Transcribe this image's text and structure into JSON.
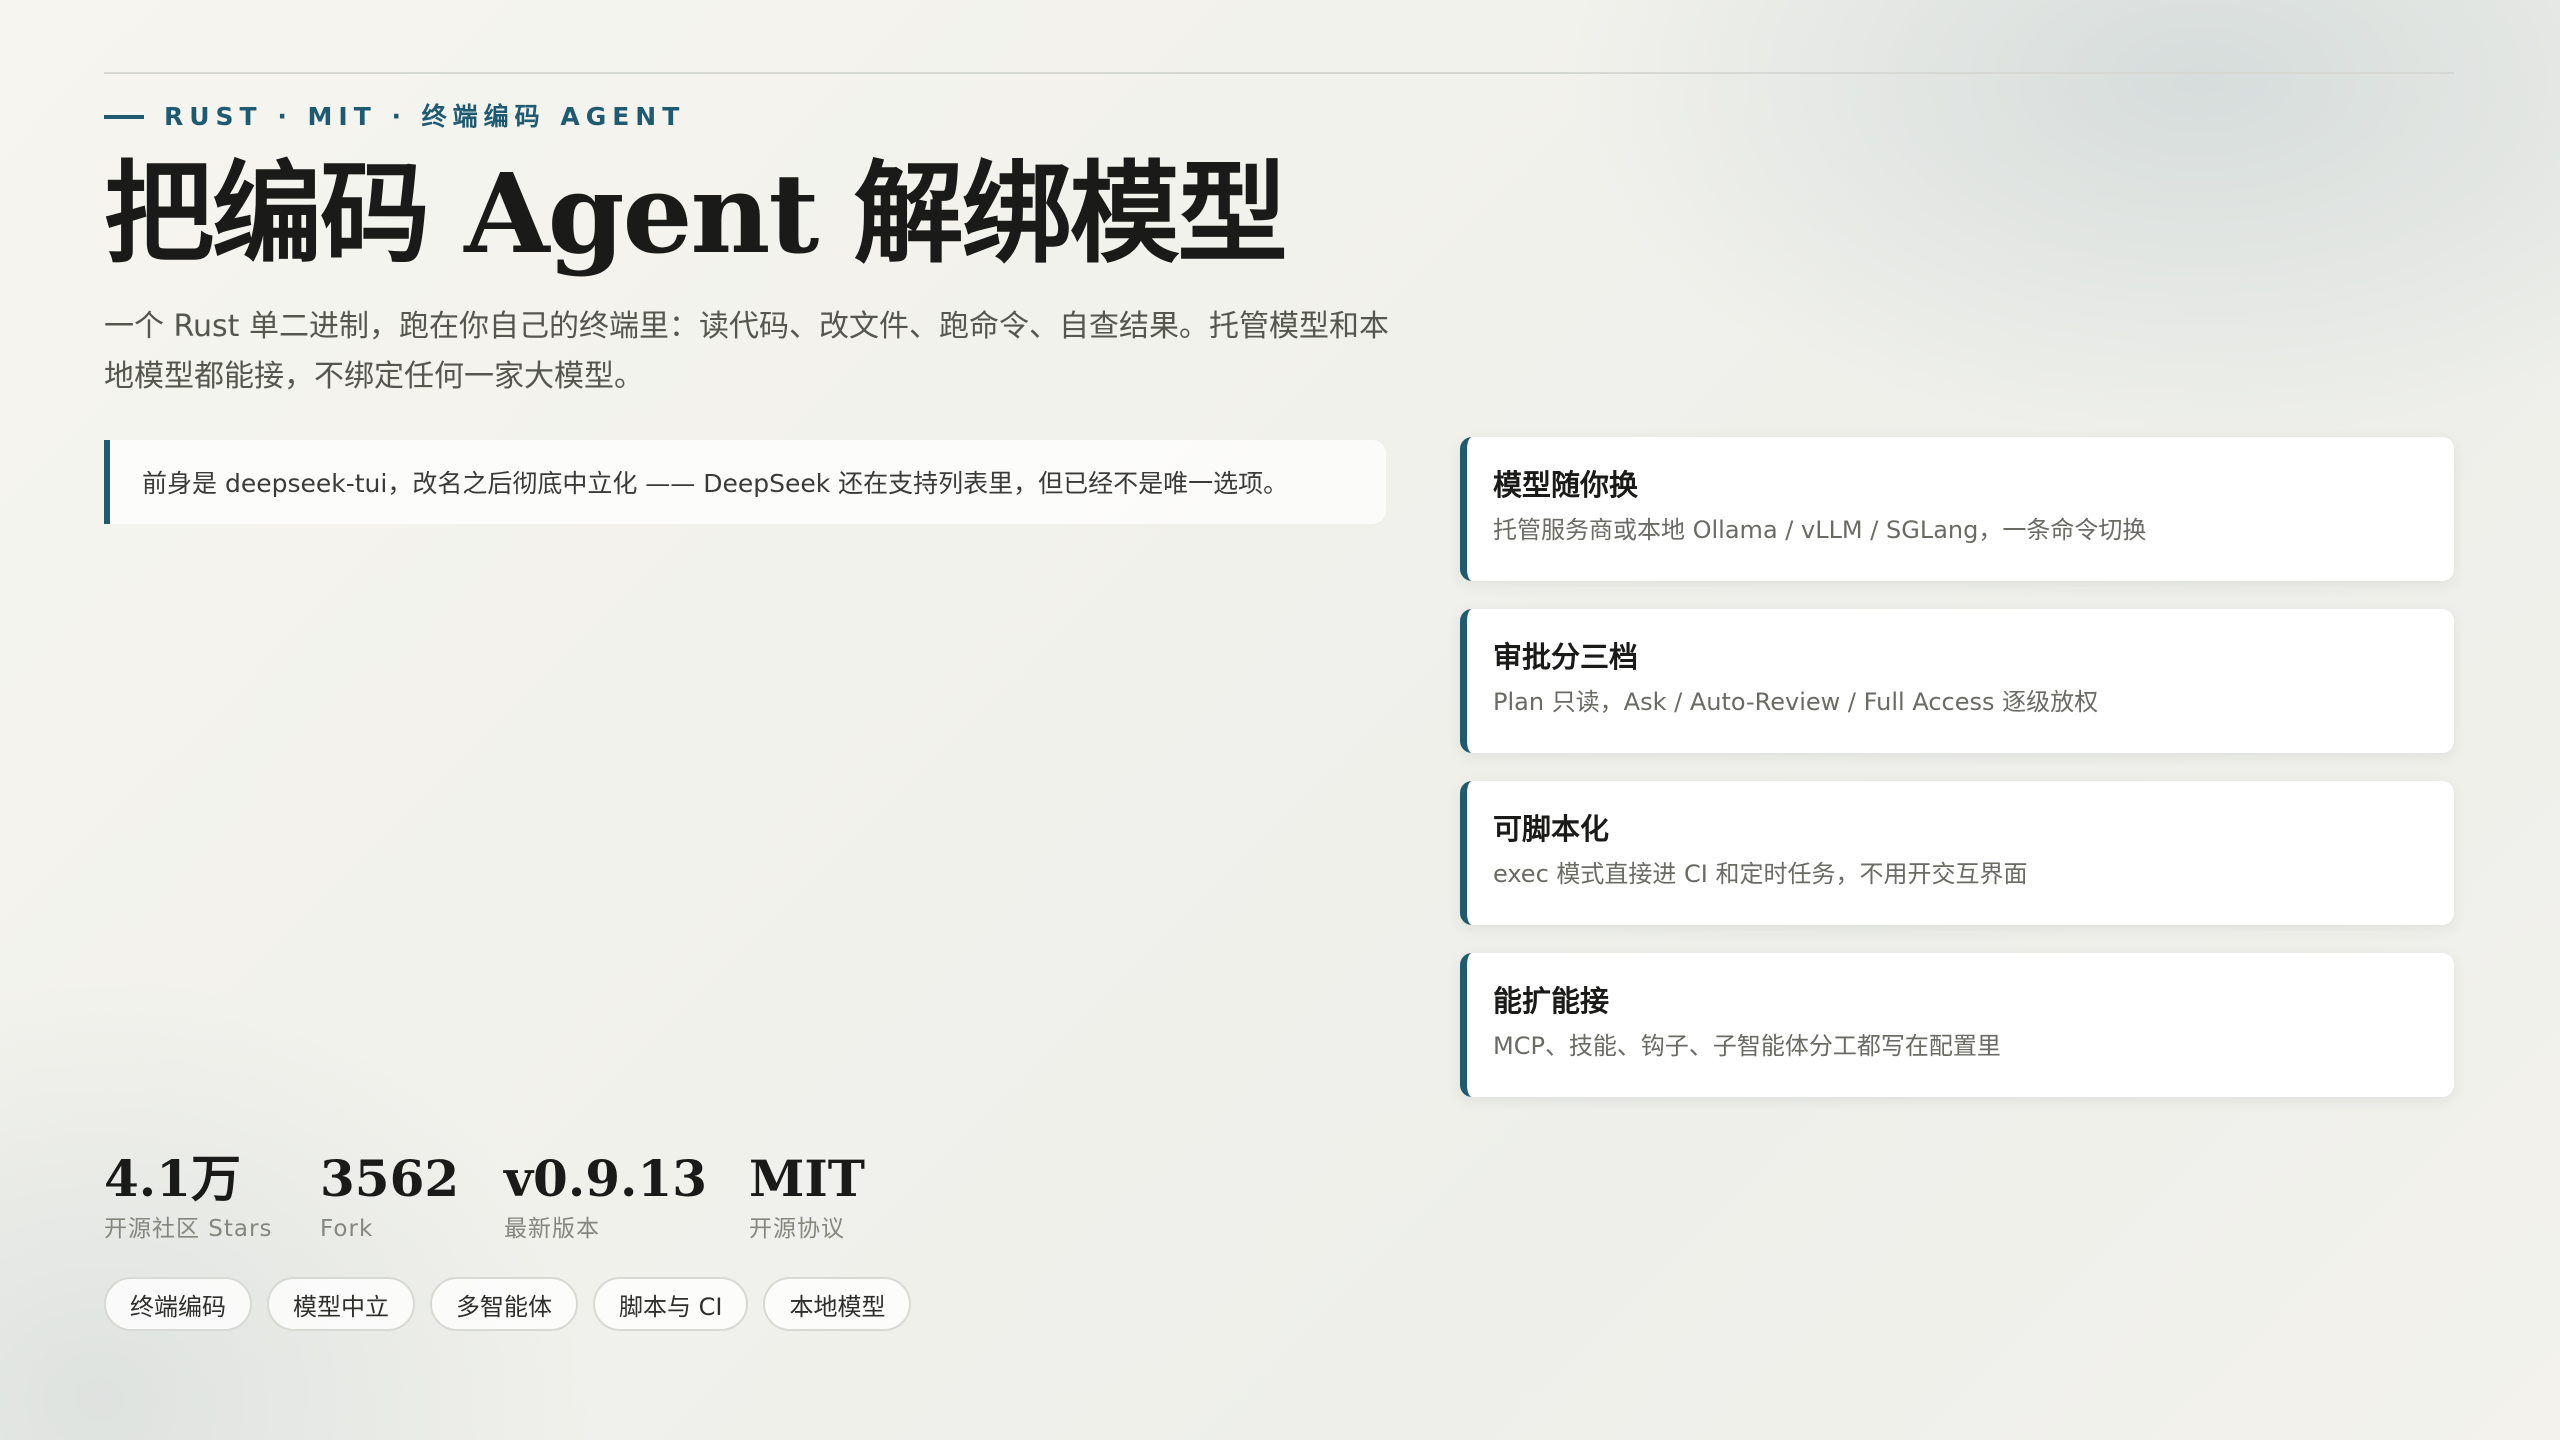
{
  "header": {
    "eyebrow": "RUST · MIT · 终端编码 AGENT",
    "title": "把编码 Agent 解绑模型",
    "subtitle": "一个 Rust 单二进制，跑在你自己的终端里：读代码、改文件、跑命令、自查结果。托管模型和本地模型都能接，不绑定任何一家大模型。"
  },
  "note": "前身是 deepseek-tui，改名之后彻底中立化 —— DeepSeek 还在支持列表里，但已经不是唯一选项。",
  "features": [
    {
      "title": "模型随你换",
      "desc": "托管服务商或本地 Ollama / vLLM / SGLang，一条命令切换"
    },
    {
      "title": "审批分三档",
      "desc": "Plan 只读，Ask / Auto-Review / Full Access 逐级放权"
    },
    {
      "title": "可脚本化",
      "desc": "exec 模式直接进 CI 和定时任务，不用开交互界面"
    },
    {
      "title": "能扩能接",
      "desc": "MCP、技能、钩子、子智能体分工都写在配置里"
    }
  ],
  "stats": [
    {
      "value": "4.1万",
      "label": "开源社区 Stars"
    },
    {
      "value": "3562",
      "label": "Fork"
    },
    {
      "value": "v0.9.13",
      "label": "最新版本"
    },
    {
      "value": "MIT",
      "label": "开源协议"
    }
  ],
  "tags": [
    "终端编码",
    "模型中立",
    "多智能体",
    "脚本与 CI",
    "本地模型"
  ],
  "colors": {
    "accent": "#1f5a73",
    "text": "#1a1b18",
    "muted": "#6a6b64"
  }
}
